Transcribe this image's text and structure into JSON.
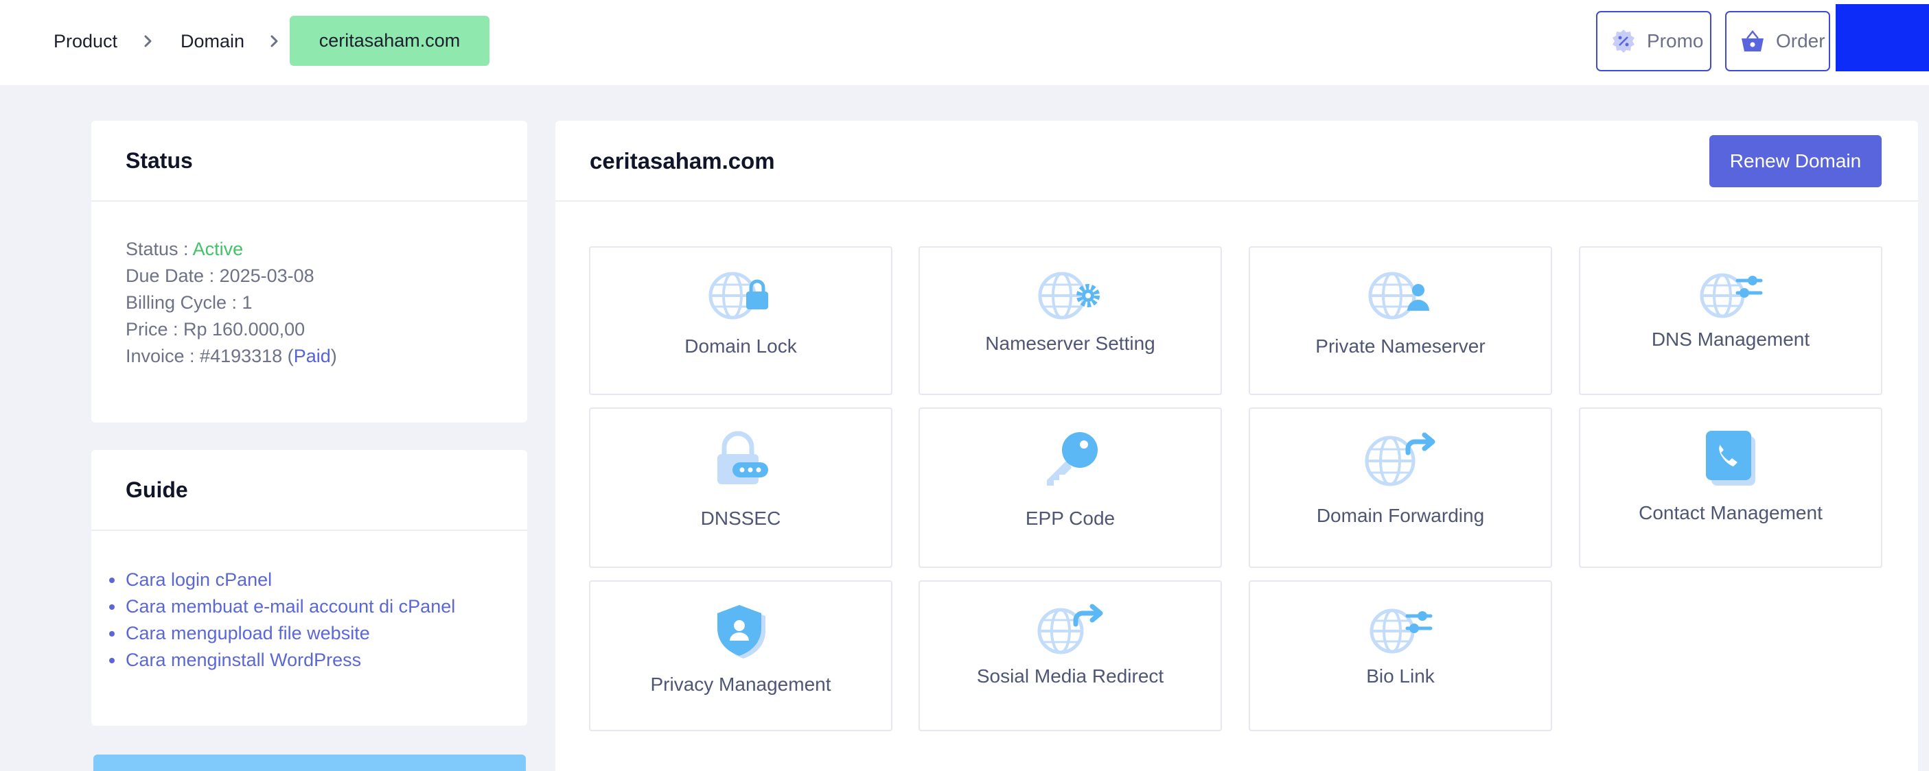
{
  "breadcrumb": {
    "items": [
      "Product",
      "Domain"
    ],
    "current": "ceritasaham.com"
  },
  "topbar": {
    "promo_label": "Promo",
    "order_label": "Order"
  },
  "status_card": {
    "title": "Status",
    "status_label": "Status : ",
    "status_value": "Active",
    "due_date": "Due Date : 2025-03-08",
    "billing_cycle": "Billing Cycle : 1",
    "price": "Price : Rp 160.000,00",
    "invoice_prefix": "Invoice : #4193318 (",
    "invoice_status": "Paid",
    "invoice_suffix": ")"
  },
  "guide_card": {
    "title": "Guide",
    "links": [
      "Cara login cPanel",
      "Cara membuat e-mail account di cPanel",
      "Cara mengupload file website",
      "Cara menginstall WordPress"
    ]
  },
  "main": {
    "domain_title": "ceritasaham.com",
    "renew_label": "Renew Domain",
    "tiles": [
      {
        "label": "Domain Lock",
        "icon": "globe-lock-icon"
      },
      {
        "label": "Nameserver Setting",
        "icon": "globe-gear-icon"
      },
      {
        "label": "Private Nameserver",
        "icon": "globe-user-icon"
      },
      {
        "label": "DNS Management",
        "icon": "globe-sliders-icon"
      },
      {
        "label": "DNSSEC",
        "icon": "padlock-icon"
      },
      {
        "label": "EPP Code",
        "icon": "key-icon"
      },
      {
        "label": "Domain Forwarding",
        "icon": "globe-forward-icon"
      },
      {
        "label": "Contact Management",
        "icon": "phone-book-icon"
      },
      {
        "label": "Privacy Management",
        "icon": "shield-user-icon"
      },
      {
        "label": "Sosial Media Redirect",
        "icon": "globe-forward-icon"
      },
      {
        "label": "Bio Link",
        "icon": "globe-sliders-icon"
      }
    ]
  },
  "colors": {
    "accent": "#5865dc",
    "active": "#43c26a",
    "breadcrumb_highlight": "#8fe8ad",
    "icon_light": "#c3dcfa",
    "icon_strong": "#5bb8f5"
  }
}
